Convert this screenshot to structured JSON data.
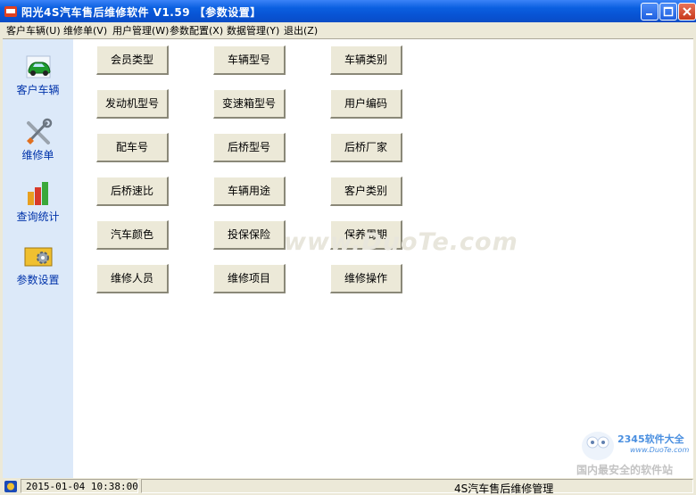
{
  "window": {
    "title": "阳光4S汽车售后维修软件 V1.59 【参数设置】"
  },
  "menu": [
    "客户车辆(U)",
    "维修单(V)",
    "用户管理(W)",
    "参数配置(X)",
    "数据管理(Y)",
    "退出(Z)"
  ],
  "sidebar": {
    "items": [
      {
        "label": "客户车辆",
        "icon": "car-icon"
      },
      {
        "label": "维修单",
        "icon": "tools-icon"
      },
      {
        "label": "查询统计",
        "icon": "chart-icon"
      },
      {
        "label": "参数设置",
        "icon": "settings-icon"
      }
    ]
  },
  "buttons": [
    [
      "会员类型",
      "车辆型号",
      "车辆类别"
    ],
    [
      "发动机型号",
      "变速箱型号",
      "用户编码"
    ],
    [
      "配车号",
      "后桥型号",
      "后桥厂家"
    ],
    [
      "后桥速比",
      "车辆用途",
      "客户类别"
    ],
    [
      "汽车颜色",
      "投保保险",
      "保养周期"
    ],
    [
      "维修人员",
      "维修项目",
      "维修操作"
    ]
  ],
  "status": {
    "datetime": "2015-01-04 10:38:00",
    "app_name": "4S汽车售后维修管理"
  },
  "watermark": {
    "text": "www.DuoTe.com",
    "brand": "2345软件大全",
    "url": "www.DuoTe.com",
    "slogan": "国内最安全的软件站"
  },
  "colors": {
    "title_blue": "#0a5fe0",
    "sidebar_bg": "#dce9f9",
    "button_face": "#ece9d8"
  }
}
